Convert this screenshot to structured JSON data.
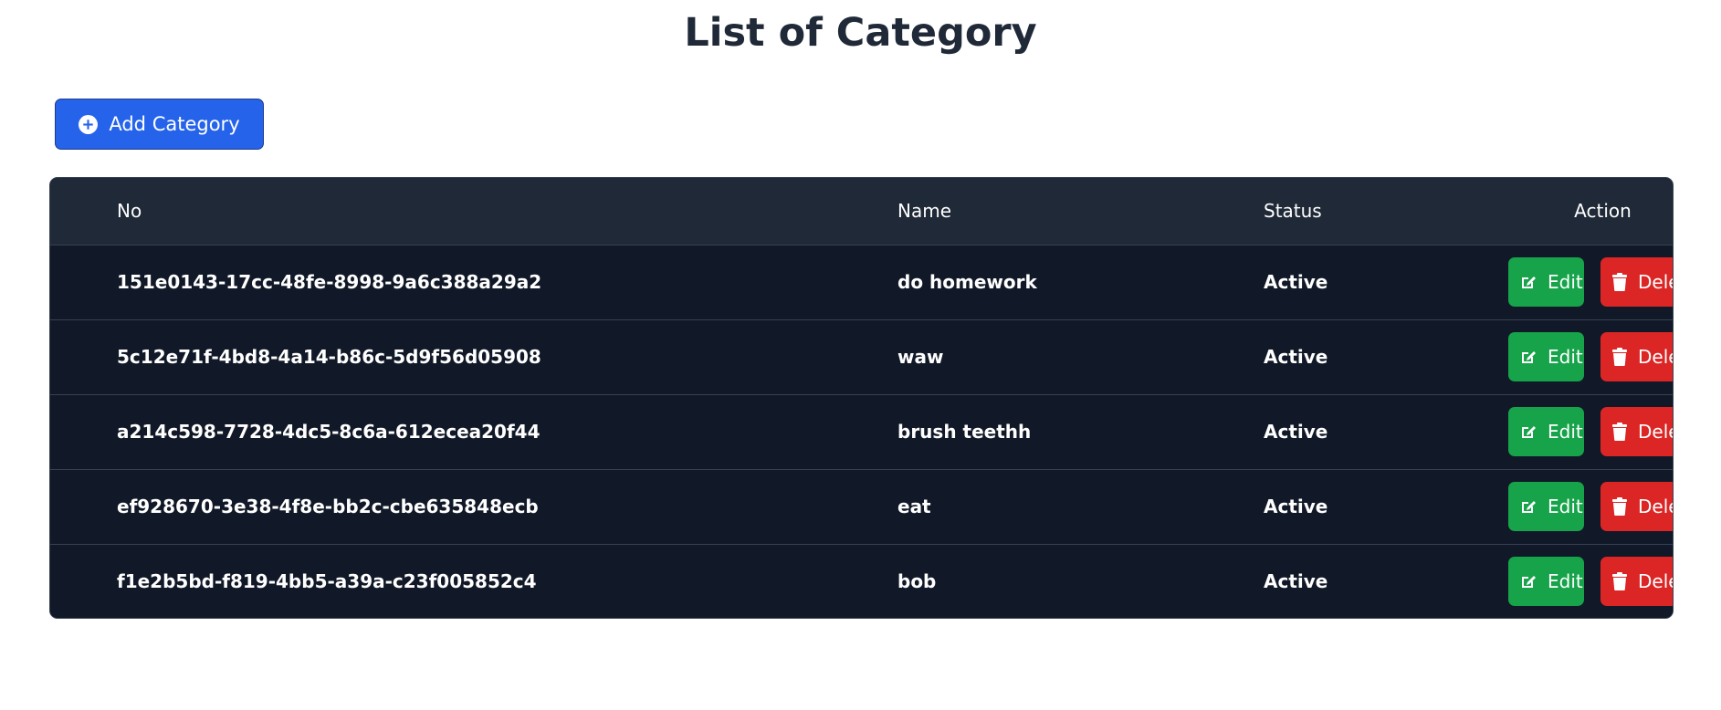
{
  "page": {
    "title": "List of Category"
  },
  "toolbar": {
    "add_label": "Add Category",
    "add_icon": "plus-circle-icon"
  },
  "table": {
    "headers": {
      "no": "No",
      "name": "Name",
      "status": "Status",
      "action": "Action"
    },
    "rows": [
      {
        "no": "151e0143-17cc-48fe-8998-9a6c388a29a2",
        "name": "do homework",
        "status": "Active",
        "edit": "Edit",
        "delete": "Delete"
      },
      {
        "no": "5c12e71f-4bd8-4a14-b86c-5d9f56d05908",
        "name": "waw",
        "status": "Active",
        "edit": "Edit",
        "delete": "Delete"
      },
      {
        "no": "a214c598-7728-4dc5-8c6a-612ecea20f44",
        "name": "brush teethh",
        "status": "Active",
        "edit": "Edit",
        "delete": "Delete"
      },
      {
        "no": "ef928670-3e38-4f8e-bb2c-cbe635848ecb",
        "name": "eat",
        "status": "Active",
        "edit": "Edit",
        "delete": "Delete"
      },
      {
        "no": "f1e2b5bd-f819-4bb5-a39a-c23f005852c4",
        "name": "bob",
        "status": "Active",
        "edit": "Edit",
        "delete": "Delete"
      }
    ]
  },
  "icons": {
    "edit": "edit-icon",
    "delete": "trash-icon"
  },
  "colors": {
    "primary": "#2563eb",
    "success": "#16a34a",
    "danger": "#dc2626",
    "table_header": "#1f2937",
    "table_body": "#111827"
  }
}
